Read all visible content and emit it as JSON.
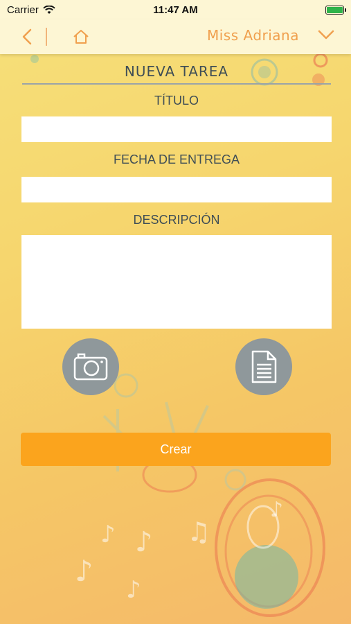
{
  "status_bar": {
    "carrier": "Carrier",
    "time": "11:47 AM"
  },
  "nav": {
    "user_name": "Miss Adriana"
  },
  "form": {
    "title": "NUEVA TAREA",
    "titulo_label": "TÍTULO",
    "titulo_value": "",
    "fecha_label": "FECHA DE ENTREGA",
    "fecha_value": "",
    "descripcion_label": "DESCRIPCIÓN",
    "descripcion_value": ""
  },
  "actions": {
    "camera_icon": "camera-icon",
    "document_icon": "document-icon",
    "create_label": "Crear"
  },
  "colors": {
    "accent": "#fba41d",
    "bar_bg": "#fdf6d4",
    "nav_accent": "#f0a04e",
    "round_btn": "#8f989b"
  }
}
